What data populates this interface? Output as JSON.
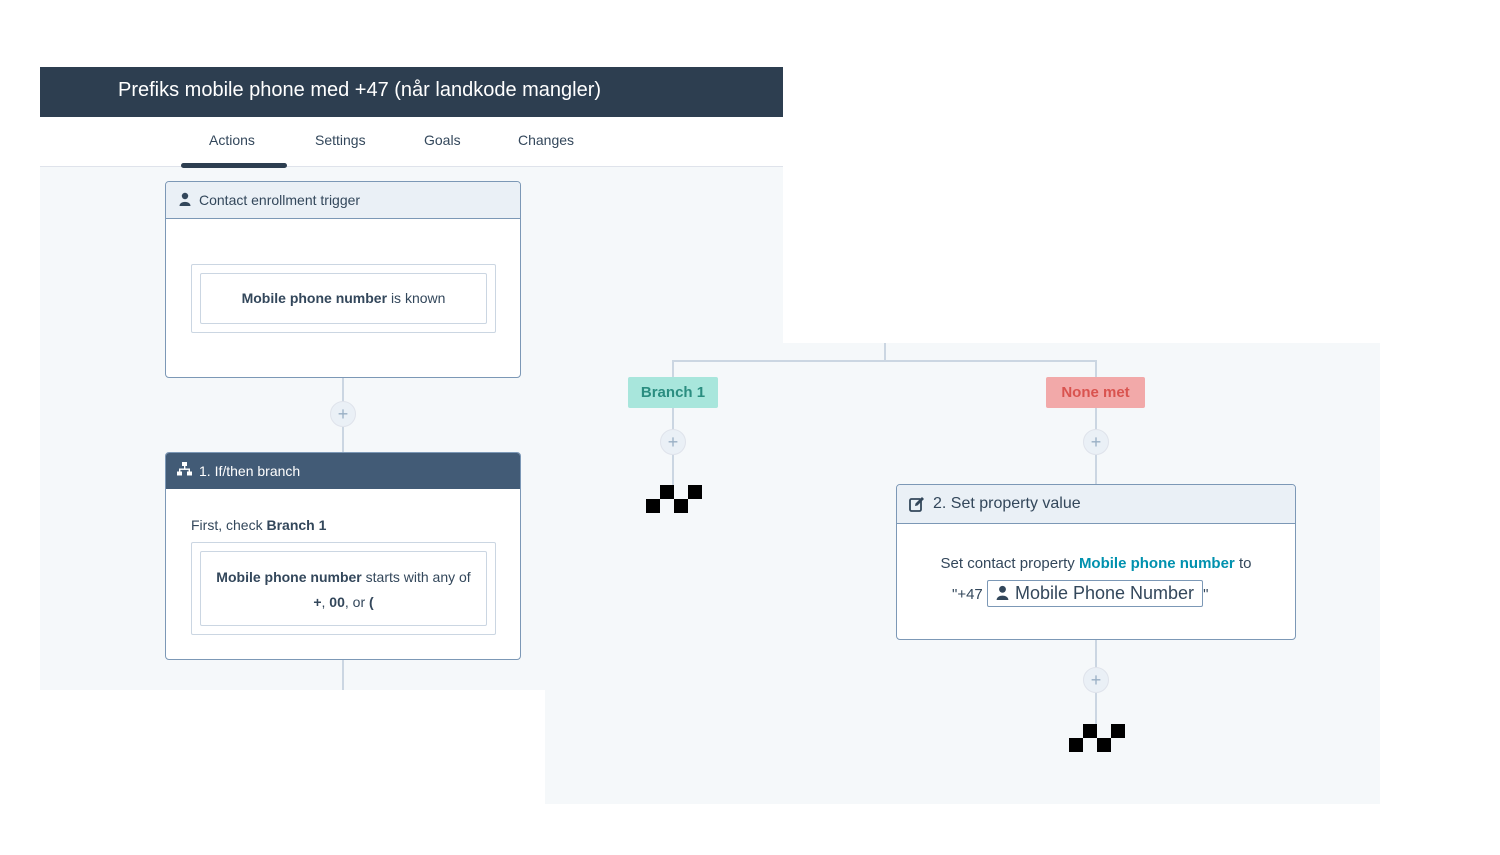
{
  "workflow": {
    "title": "Prefiks mobile phone med +47 (når landkode mangler)",
    "tabs": [
      "Actions",
      "Settings",
      "Goals",
      "Changes"
    ],
    "active_tab": "Actions"
  },
  "trigger": {
    "header": "Contact enrollment trigger",
    "filter_property": "Mobile phone number",
    "filter_operator": "is known"
  },
  "branch_action": {
    "header": "1. If/then branch",
    "first_check_prefix": "First, check",
    "first_check_branch": "Branch 1",
    "filter_property": "Mobile phone number",
    "filter_operator": "starts with any of",
    "value1": "+",
    "sep1": ",",
    "value2": "00",
    "sep2": ", or",
    "value3": "("
  },
  "branches": {
    "branch1_label": "Branch 1",
    "none_met_label": "None met",
    "branch1_color": "#a8e6dc",
    "none_met_color": "#f2a9a9"
  },
  "set_property_action": {
    "header": "2. Set property value",
    "text_prefix": "Set contact property",
    "property": "Mobile phone number",
    "text_to": "to",
    "value_prefix": "\"+47",
    "token_label": "Mobile Phone Number",
    "value_suffix": "\""
  },
  "icons": {
    "contact": "person-icon",
    "branch": "branch-icon",
    "edit": "edit-icon",
    "add": "plus-icon",
    "end": "finish-flag-icon"
  },
  "plus_symbol": "+"
}
